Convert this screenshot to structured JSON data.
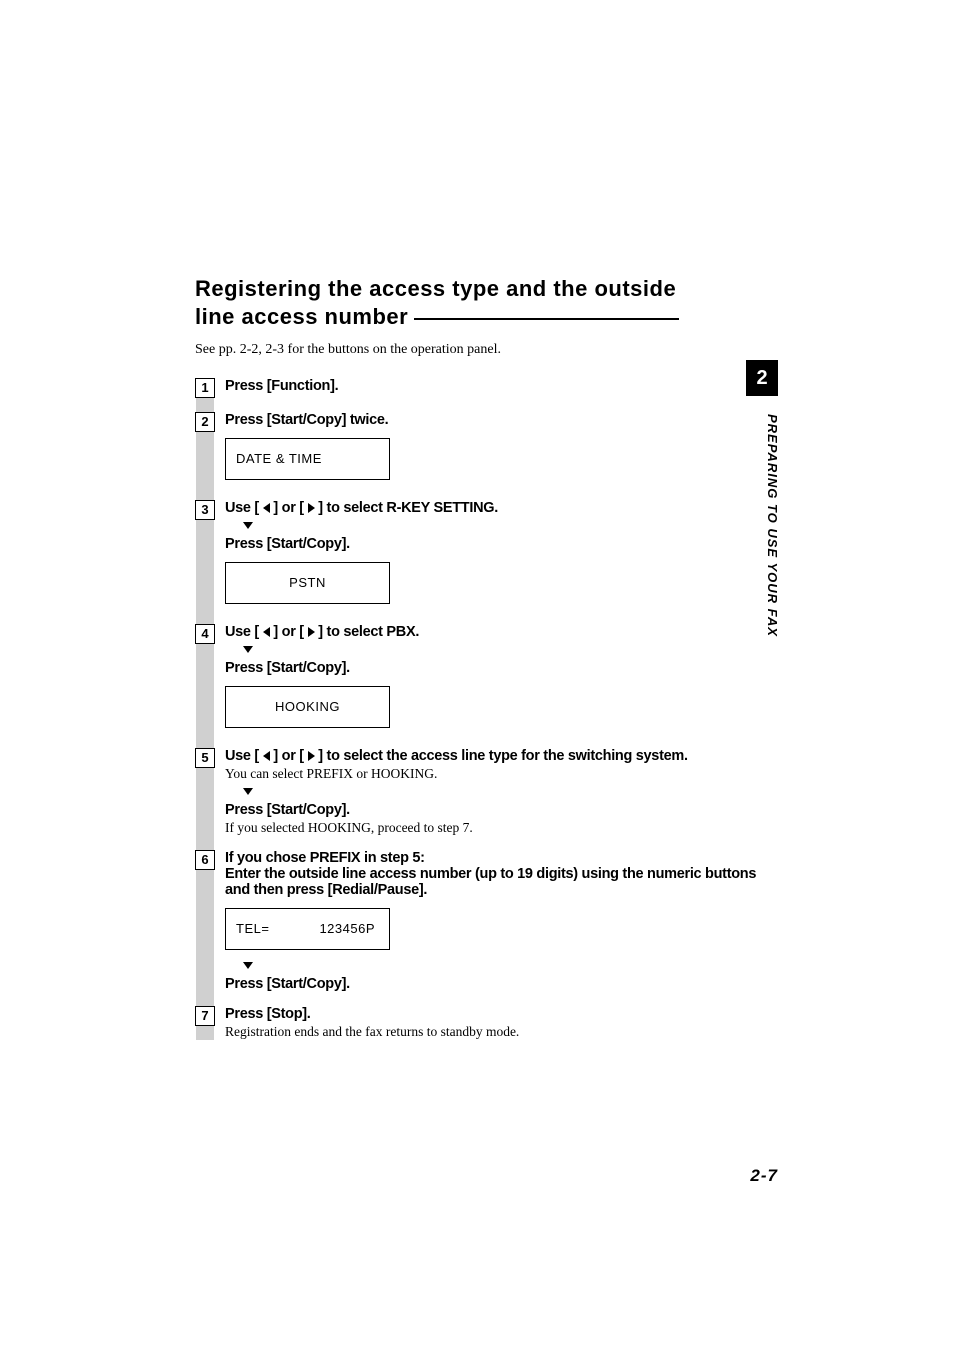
{
  "heading_line1": "Registering the access type and the outside",
  "heading_line2": "line access number",
  "intro": "See pp. 2-2, 2-3 for the buttons on the operation panel.",
  "steps": {
    "s1": {
      "num": "1",
      "title": "Press [Function]."
    },
    "s2": {
      "num": "2",
      "title": "Press [Start/Copy] twice.",
      "lcd": "DATE & TIME"
    },
    "s3": {
      "num": "3",
      "title_pre": "Use [ ",
      "title_mid": " ] or [ ",
      "title_post": " ] to select R-KEY SETTING.",
      "press": "Press [Start/Copy].",
      "lcd": "PSTN"
    },
    "s4": {
      "num": "4",
      "title_pre": "Use [ ",
      "title_mid": " ] or [ ",
      "title_post": " ] to select PBX.",
      "press": "Press [Start/Copy].",
      "lcd": "HOOKING"
    },
    "s5": {
      "num": "5",
      "title_pre": "Use [ ",
      "title_mid": " ] or [ ",
      "title_post": " ] to select the access line type for the switching system.",
      "note1": "You can select PREFIX or HOOKING.",
      "press": "Press [Start/Copy].",
      "note2": "If you selected HOOKING, proceed to step 7."
    },
    "s6": {
      "num": "6",
      "line1": "If you chose PREFIX in step 5:",
      "line2": "Enter the outside line access number (up to 19 digits) using the numeric buttons and then press [Redial/Pause].",
      "lcd_left": "TEL=",
      "lcd_right": "123456P",
      "press": "Press [Start/Copy]."
    },
    "s7": {
      "num": "7",
      "title": "Press [Stop].",
      "note": "Registration ends and the fax returns to standby mode."
    }
  },
  "chapter_num": "2",
  "side_label": "PREPARING TO USE YOUR FAX",
  "page_num": "2-7"
}
